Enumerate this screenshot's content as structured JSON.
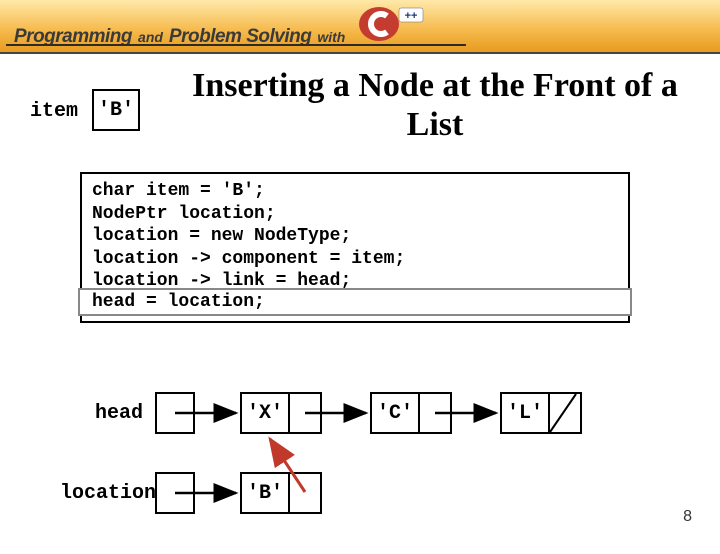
{
  "header": {
    "word1": "Programming",
    "word2": "and",
    "word3": "Problem Solving",
    "word4": "with",
    "cpp_plus": "++"
  },
  "slide": {
    "title": "Inserting a Node at the Front of a List",
    "item_label": "item",
    "item_value": "'B'",
    "code": {
      "l1": "char     item = 'B';",
      "l2": "NodePtr  location;",
      "l3": "location = new  NodeType;",
      "l4": "location -> component = item;",
      "l5": "location -> link = head;",
      "l6": "head = location;"
    },
    "diagram": {
      "head_label": "head",
      "location_label": "location",
      "node_x": "'X'",
      "node_c": "'C'",
      "node_l": "'L'",
      "node_b": "'B'"
    },
    "page_number": "8"
  }
}
